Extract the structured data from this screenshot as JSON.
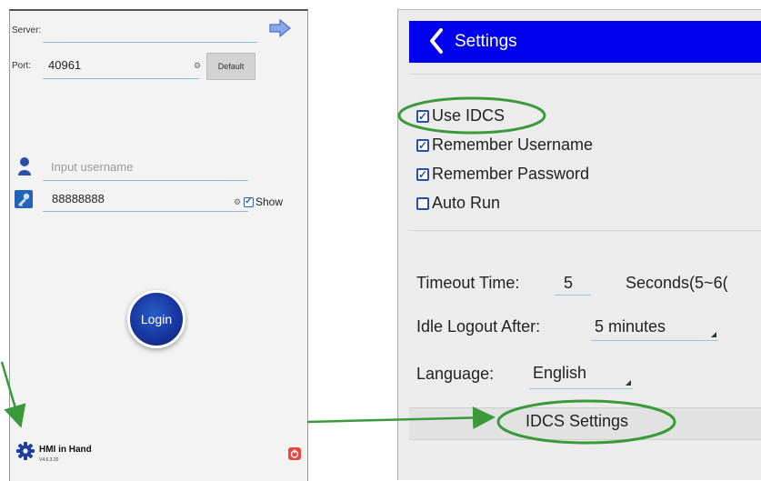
{
  "login": {
    "server_label": "Server:",
    "server_value": "",
    "port_label": "Port:",
    "port_value": "40961",
    "default_label": "Default",
    "username_placeholder": "Input username",
    "password_value": "88888888",
    "show_label": "Show",
    "show_checked": true,
    "login_label": "Login",
    "app_name": "HMI in Hand",
    "app_version": "V4.6.3.20"
  },
  "settings": {
    "title": "Settings",
    "options": [
      {
        "label": "Use IDCS",
        "checked": true
      },
      {
        "label": "Remember Username",
        "checked": true
      },
      {
        "label": "Remember Password",
        "checked": true
      },
      {
        "label": "Auto Run",
        "checked": false
      }
    ],
    "timeout_label": "Timeout Time:",
    "timeout_value": "5",
    "timeout_unit": "Seconds(5~6(",
    "idle_label": "Idle Logout After:",
    "idle_value": "5 minutes",
    "language_label": "Language:",
    "language_value": "English",
    "idcs_settings_label": "IDCS Settings"
  },
  "colors": {
    "header_blue": "#0000ee",
    "highlight_green": "#3a9a3a",
    "accent_blue": "#2b5fb3"
  }
}
